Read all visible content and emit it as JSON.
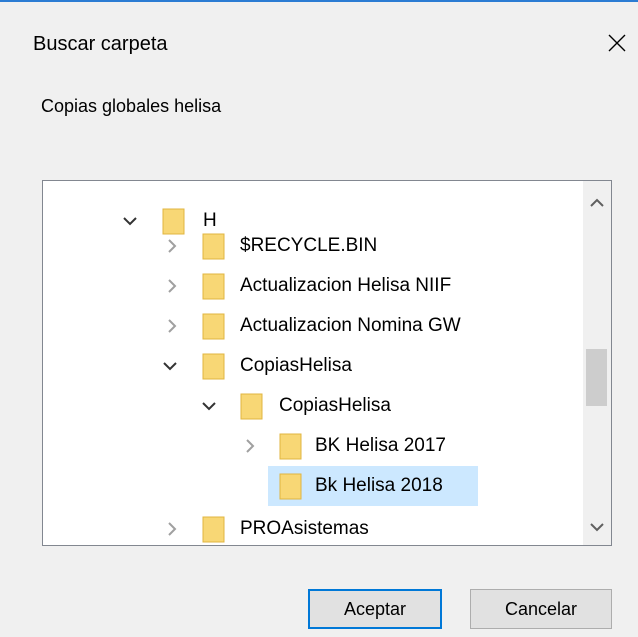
{
  "dialog": {
    "title": "Buscar carpeta",
    "description": "Copias globales helisa",
    "close_icon": "close-icon"
  },
  "tree": {
    "items": [
      {
        "label": "H",
        "expanded": true,
        "selected": false
      },
      {
        "label": "$RECYCLE.BIN",
        "expanded": false,
        "selected": false
      },
      {
        "label": "Actualizacion Helisa NIIF",
        "expanded": false,
        "selected": false
      },
      {
        "label": "Actualizacion Nomina GW",
        "expanded": false,
        "selected": false
      },
      {
        "label": "CopiasHelisa",
        "expanded": true,
        "selected": false
      },
      {
        "label": "CopiasHelisa",
        "expanded": true,
        "selected": false
      },
      {
        "label": "BK Helisa 2017",
        "expanded": false,
        "selected": false
      },
      {
        "label": "Bk Helisa 2018",
        "expanded": false,
        "selected": true
      },
      {
        "label": "PROAsistemas",
        "expanded": false,
        "selected": false
      }
    ]
  },
  "buttons": {
    "accept": "Aceptar",
    "cancel": "Cancelar"
  },
  "colors": {
    "accent": "#0078d7",
    "selection": "#cce8ff",
    "folder": "#f8d775"
  }
}
